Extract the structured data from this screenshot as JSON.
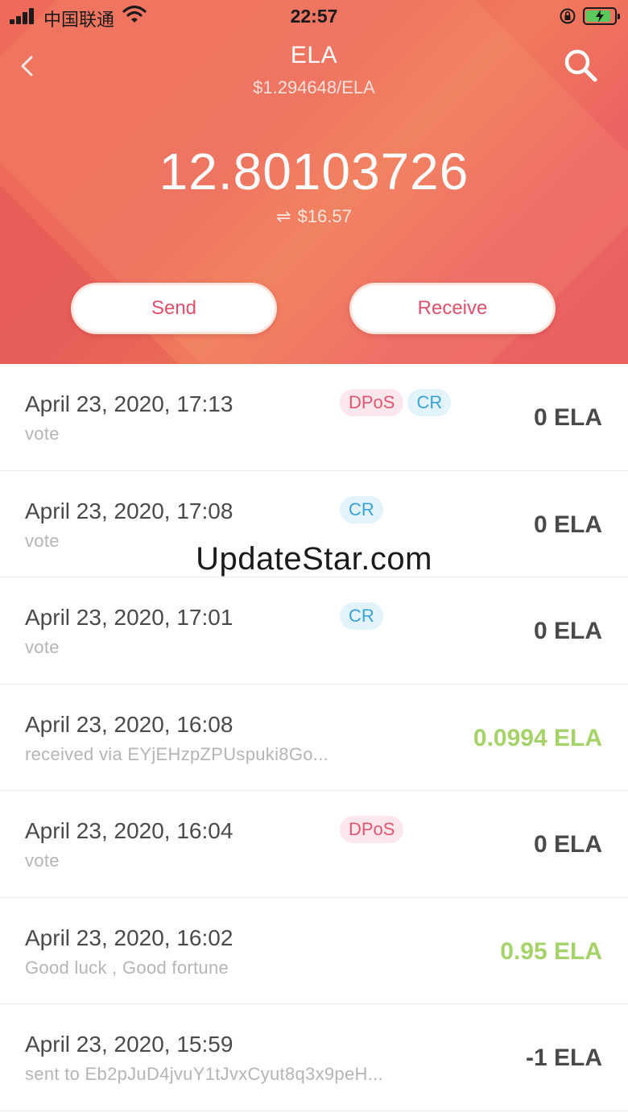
{
  "status_bar": {
    "carrier": "中国联通",
    "time": "22:57"
  },
  "header": {
    "title": "ELA",
    "price": "$1.294648/ELA",
    "balance": "12.80103726",
    "fiat_symbol": "⇌",
    "fiat_value": "$16.57",
    "send_label": "Send",
    "receive_label": "Receive"
  },
  "colors": {
    "header_accent": "#ee6a5a",
    "button_text": "#e0506a",
    "positive_amount": "#a6d26a",
    "dpos_tag": "#e45470",
    "cr_tag": "#3aa3d6"
  },
  "transactions": [
    {
      "date": "April 23, 2020, 17:13",
      "desc": "vote",
      "amount": "0 ELA",
      "tags": [
        "DPoS",
        "CR"
      ]
    },
    {
      "date": "April 23, 2020, 17:08",
      "desc": "vote",
      "amount": "0 ELA",
      "tags": [
        "CR"
      ]
    },
    {
      "date": "April 23, 2020, 17:01",
      "desc": "vote",
      "amount": "0 ELA",
      "tags": [
        "CR"
      ]
    },
    {
      "date": "April 23, 2020, 16:08",
      "desc": "received via EYjEHzpZPUspuki8Go...",
      "amount": "0.0994 ELA",
      "tags": []
    },
    {
      "date": "April 23, 2020, 16:04",
      "desc": "vote",
      "amount": "0 ELA",
      "tags": [
        "DPoS"
      ]
    },
    {
      "date": "April 23, 2020, 16:02",
      "desc": "Good luck , Good fortune",
      "amount": "0.95 ELA",
      "tags": []
    },
    {
      "date": "April 23, 2020, 15:59",
      "desc": "sent to Eb2pJuD4jvuY1tJvxCyut8q3x9peH...",
      "amount": "-1 ELA",
      "tags": []
    }
  ],
  "watermark": "UpdateStar.com"
}
